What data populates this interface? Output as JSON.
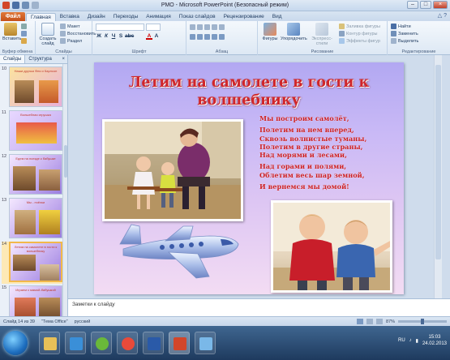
{
  "window": {
    "title": "РМО - Microsoft PowerPoint (Безопасный режим)"
  },
  "tabs": {
    "file": "Файл",
    "items": [
      "Главная",
      "Вставка",
      "Дизайн",
      "Переходы",
      "Анимация",
      "Показ слайдов",
      "Рецензирование",
      "Вид"
    ],
    "active_index": 0
  },
  "ribbon": {
    "clipboard": {
      "paste": "Вставить",
      "label": "Буфер обмена"
    },
    "slides": {
      "create": "Создать слайд",
      "layout": "Макет",
      "reset": "Восстановить",
      "section": "Раздел",
      "label": "Слайды"
    },
    "font": {
      "label": "Шрифт"
    },
    "paragraph": {
      "label": "Абзац"
    },
    "drawing": {
      "shapes": "Фигуры",
      "arrange": "Упорядочить",
      "styles": "Экспресс-стили",
      "fill": "Заливка фигуры",
      "outline": "Контур фигуры",
      "effects": "Эффекты фигур",
      "label": "Рисование"
    },
    "editing": {
      "find": "Найти",
      "replace": "Заменить",
      "select": "Выделить",
      "label": "Редактирование"
    }
  },
  "sidepanel": {
    "tab_slides": "Слайды",
    "tab_outline": "Структура",
    "close": "×",
    "thumbs": [
      {
        "num": "10",
        "title": "Наши друзья Фея и Карлсон"
      },
      {
        "num": "11",
        "title": "Волшебная игрушка"
      },
      {
        "num": "12",
        "title": "Едем на поезде к бабушке"
      },
      {
        "num": "13",
        "title": "Мы - пчёлки"
      },
      {
        "num": "14",
        "title": "Летим на самолете в гости к волшебнику"
      },
      {
        "num": "15",
        "title": "Играем с мамой-бабушкой"
      }
    ],
    "selected_index": 4
  },
  "slide": {
    "title": "Летим на самолете в гости к волшебнику",
    "poem": [
      "Мы построим самолёт,",
      "Полетим на нем вперед,",
      "Сквозь волнистые туманы,",
      "Полетим в другие страны,",
      "Над морями и лесами,",
      "Над горами и полями,",
      "Облетим весь шар земной,",
      "И вернемся мы домой!"
    ]
  },
  "notes": {
    "placeholder": "Заметки к слайду"
  },
  "status": {
    "slide": "Слайд 14 из 39",
    "theme": "\"Тема Office\"",
    "lang": "русский",
    "zoom": "87%"
  },
  "taskbar": {
    "lang": "RU",
    "time": "15:03",
    "date": "24.02.2013"
  },
  "colors": {
    "title_red": "#d0262a",
    "accent_file": "#c4501a"
  }
}
